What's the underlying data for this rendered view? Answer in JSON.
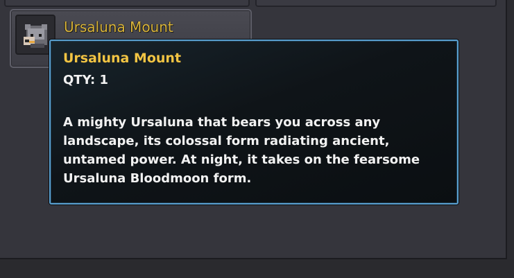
{
  "item_slot": {
    "name": "Ursaluna Mount",
    "icon": "ursaluna-bear-icon"
  },
  "tooltip": {
    "title": "Ursaluna Mount",
    "qty": "QTY: 1",
    "description": "A mighty Ursaluna that bears you across any landscape, its colossal form radiating ancient, untamed power. At night, it takes on the fearsome Ursaluna Bloodmoon form."
  },
  "colors": {
    "item_name": "#d9b43a",
    "tooltip_title": "#f2c443",
    "tooltip_border": "#5aa0d0",
    "tooltip_text": "#f2f2f2"
  }
}
